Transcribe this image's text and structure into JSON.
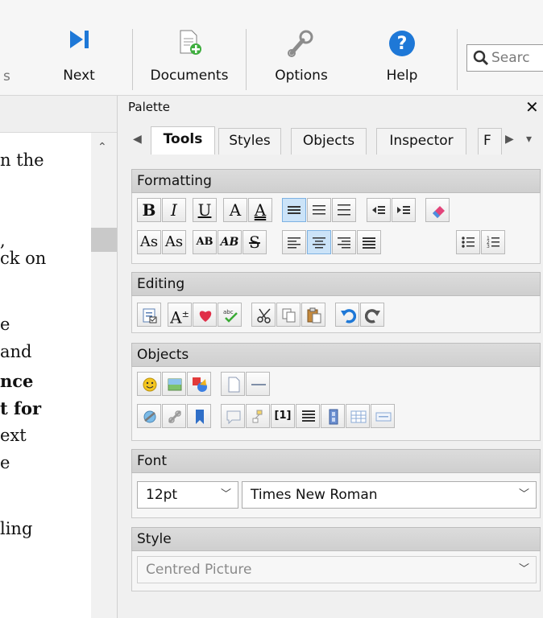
{
  "toolbar": {
    "partial_left": "s",
    "next": "Next",
    "documents": "Documents",
    "options": "Options",
    "help": "Help",
    "search_placeholder": "Searc"
  },
  "document_text": [
    {
      "text": "n the",
      "bold": false
    },
    {
      "text": ",",
      "bold": false
    },
    {
      "text": "ck on",
      "bold": false
    },
    {
      "text": "e",
      "bold": false
    },
    {
      "text": "and",
      "bold": false
    },
    {
      "text": "nce",
      "bold": true
    },
    {
      "text": "t for",
      "bold": true
    },
    {
      "text": "ext",
      "bold": false
    },
    {
      "text": "e",
      "bold": false
    },
    {
      "text": "ling",
      "bold": false
    }
  ],
  "palette": {
    "title": "Palette",
    "close": "✕",
    "tabs": [
      "Tools",
      "Styles",
      "Objects",
      "Inspector",
      "F"
    ],
    "active_tab": "Tools",
    "sections": {
      "formatting": "Formatting",
      "editing": "Editing",
      "objects": "Objects",
      "font": "Font",
      "style": "Style"
    },
    "formatting_row1": [
      "B",
      "I",
      "U",
      "A",
      "A"
    ],
    "formatting_row2": [
      "As",
      "As",
      "AB",
      "AB",
      "S"
    ],
    "font_size": "12pt",
    "font_name": "Times New Roman",
    "style_value": "Centred Picture",
    "object_index_label": "[1]"
  },
  "colors": {
    "accent": "#1e78d7",
    "selected_bg": "#cbe3f8",
    "section_header": "#d3d3d3"
  }
}
